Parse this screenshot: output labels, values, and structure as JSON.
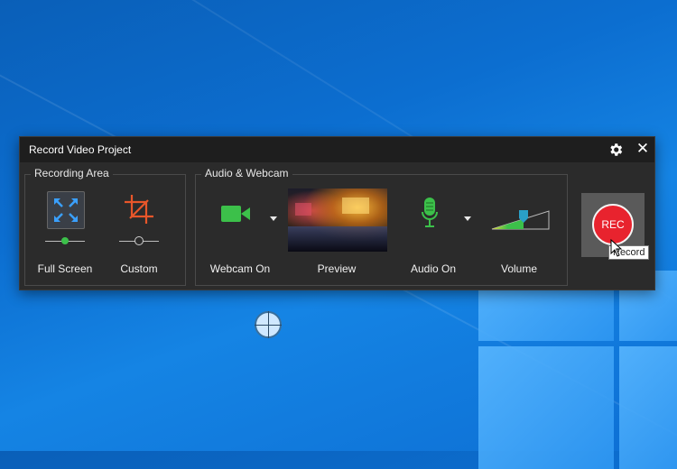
{
  "window": {
    "title": "Record Video Project"
  },
  "recording_area": {
    "group_label": "Recording Area",
    "full_screen_label": "Full Screen",
    "custom_label": "Custom"
  },
  "audio_webcam": {
    "group_label": "Audio & Webcam",
    "webcam_label": "Webcam On",
    "preview_label": "Preview",
    "audio_label": "Audio On",
    "volume_label": "Volume",
    "volume_level": 0.45
  },
  "record": {
    "button_label": "REC",
    "tooltip": "Record"
  },
  "colors": {
    "accent_blue": "#3aa0ff",
    "custom_orange": "#e8562a",
    "green": "#3cc04a",
    "rec_red": "#e8232e"
  },
  "icons": [
    "gear-icon",
    "close-icon",
    "fullscreen-icon",
    "crop-icon",
    "webcam-icon",
    "microphone-icon",
    "volume-icon",
    "crosshair-icon"
  ]
}
